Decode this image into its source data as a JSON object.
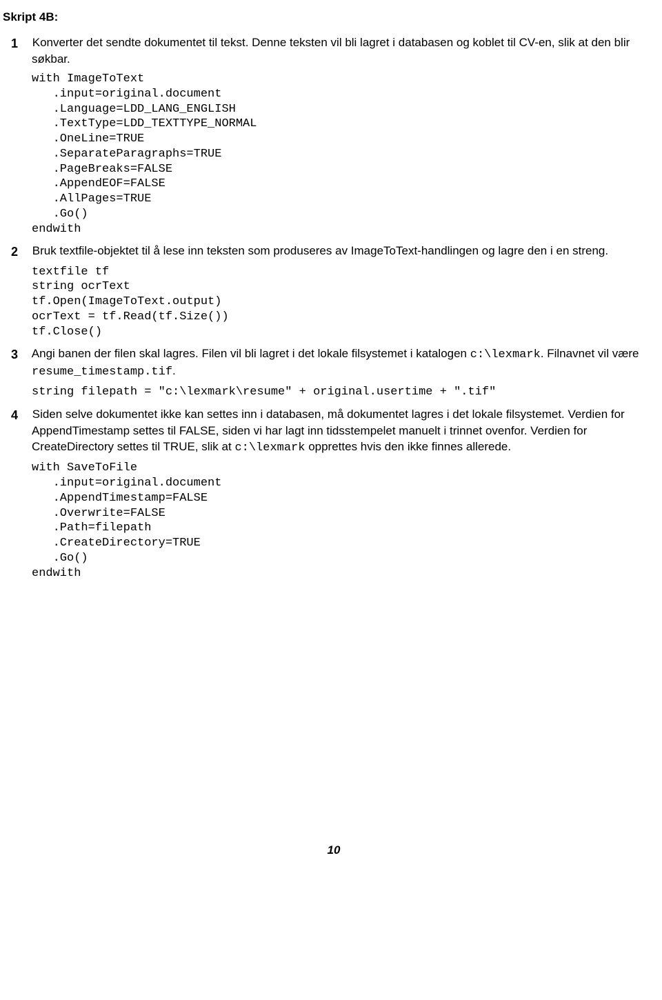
{
  "title": "Skript 4B:",
  "step1": {
    "num": "1",
    "text": "Konverter det sendte dokumentet til tekst. Denne teksten vil bli lagret i databasen og koblet til CV-en, slik at den blir søkbar."
  },
  "code1": "with ImageToText\n   .input=original.document\n   .Language=LDD_LANG_ENGLISH\n   .TextType=LDD_TEXTTYPE_NORMAL\n   .OneLine=TRUE\n   .SeparateParagraphs=TRUE\n   .PageBreaks=FALSE\n   .AppendEOF=FALSE\n   .AllPages=TRUE\n   .Go()\nendwith",
  "step2": {
    "num": "2",
    "text": "Bruk textfile-objektet til å lese inn teksten som produseres av ImageToText-handlingen og lagre den i en streng."
  },
  "code2": "textfile tf\nstring ocrText\ntf.Open(ImageToText.output)\nocrText = tf.Read(tf.Size())\ntf.Close()",
  "step3": {
    "num": "3",
    "text_a": "Angi banen der filen skal lagres. Filen vil bli lagret i det lokale filsystemet i katalogen ",
    "mono_a": "c:\\lexmark",
    "text_b": ". Filnavnet vil være ",
    "mono_b": "resume_timestamp.tif",
    "text_c": "."
  },
  "code3": "string filepath = \"c:\\lexmark\\resume\" + original.usertime + \".tif\"",
  "step4": {
    "num": "4",
    "text_a": "Siden selve dokumentet ikke kan settes inn i databasen, må dokumentet lagres i det lokale filsystemet. Verdien for AppendTimestamp settes til FALSE, siden vi har lagt inn tidsstempelet manuelt i trinnet ovenfor. Verdien for CreateDirectory settes til TRUE, slik at ",
    "mono_a": "c:\\lexmark",
    "text_b": " opprettes hvis den ikke finnes allerede."
  },
  "code4": "with SaveToFile\n   .input=original.document\n   .AppendTimestamp=FALSE\n   .Overwrite=FALSE\n   .Path=filepath\n   .CreateDirectory=TRUE\n   .Go()\nendwith",
  "pagenum": "10"
}
